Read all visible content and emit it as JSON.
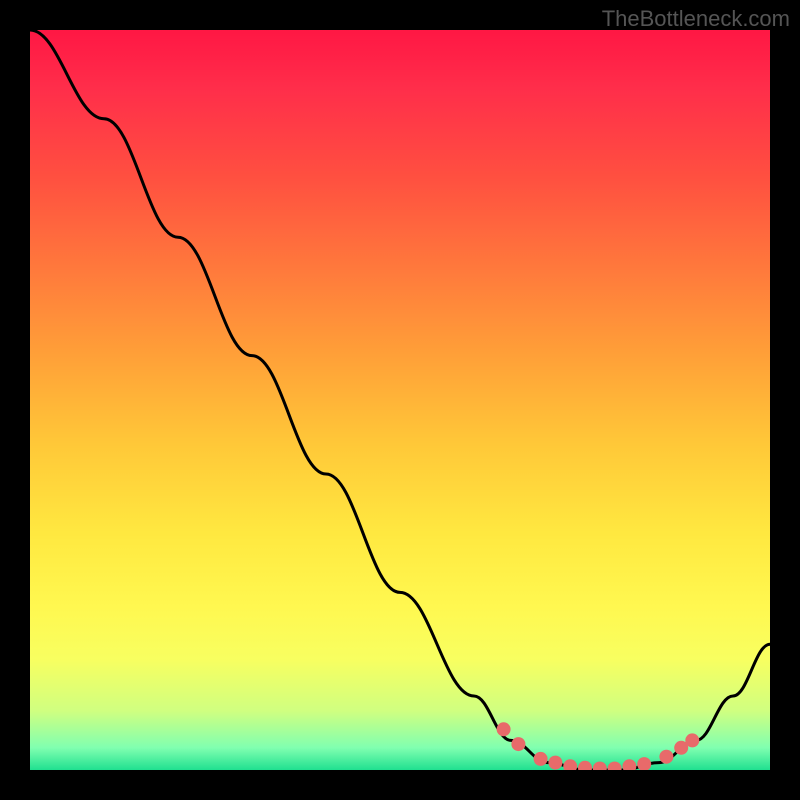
{
  "attribution": "TheBottleneck.com",
  "chart_data": {
    "type": "line",
    "title": "",
    "xlabel": "",
    "ylabel": "",
    "xlim": [
      0,
      100
    ],
    "ylim": [
      0,
      100
    ],
    "curve_points": [
      {
        "x": 0,
        "y": 100
      },
      {
        "x": 10,
        "y": 88
      },
      {
        "x": 20,
        "y": 72
      },
      {
        "x": 30,
        "y": 56
      },
      {
        "x": 40,
        "y": 40
      },
      {
        "x": 50,
        "y": 24
      },
      {
        "x": 60,
        "y": 10
      },
      {
        "x": 65,
        "y": 4
      },
      {
        "x": 70,
        "y": 1
      },
      {
        "x": 75,
        "y": 0
      },
      {
        "x": 80,
        "y": 0
      },
      {
        "x": 85,
        "y": 1
      },
      {
        "x": 90,
        "y": 4
      },
      {
        "x": 95,
        "y": 10
      },
      {
        "x": 100,
        "y": 17
      }
    ],
    "marker_points": [
      {
        "x": 64,
        "y": 5.5
      },
      {
        "x": 66,
        "y": 3.5
      },
      {
        "x": 69,
        "y": 1.5
      },
      {
        "x": 71,
        "y": 1
      },
      {
        "x": 73,
        "y": 0.5
      },
      {
        "x": 75,
        "y": 0.3
      },
      {
        "x": 77,
        "y": 0.2
      },
      {
        "x": 79,
        "y": 0.2
      },
      {
        "x": 81,
        "y": 0.5
      },
      {
        "x": 83,
        "y": 0.8
      },
      {
        "x": 86,
        "y": 1.8
      },
      {
        "x": 88,
        "y": 3
      },
      {
        "x": 89.5,
        "y": 4
      }
    ],
    "gradient_colors": {
      "top": "#ff1744",
      "mid_upper": "#ff9838",
      "mid": "#ffe040",
      "mid_lower": "#d0ff70",
      "bottom": "#20e090"
    }
  }
}
